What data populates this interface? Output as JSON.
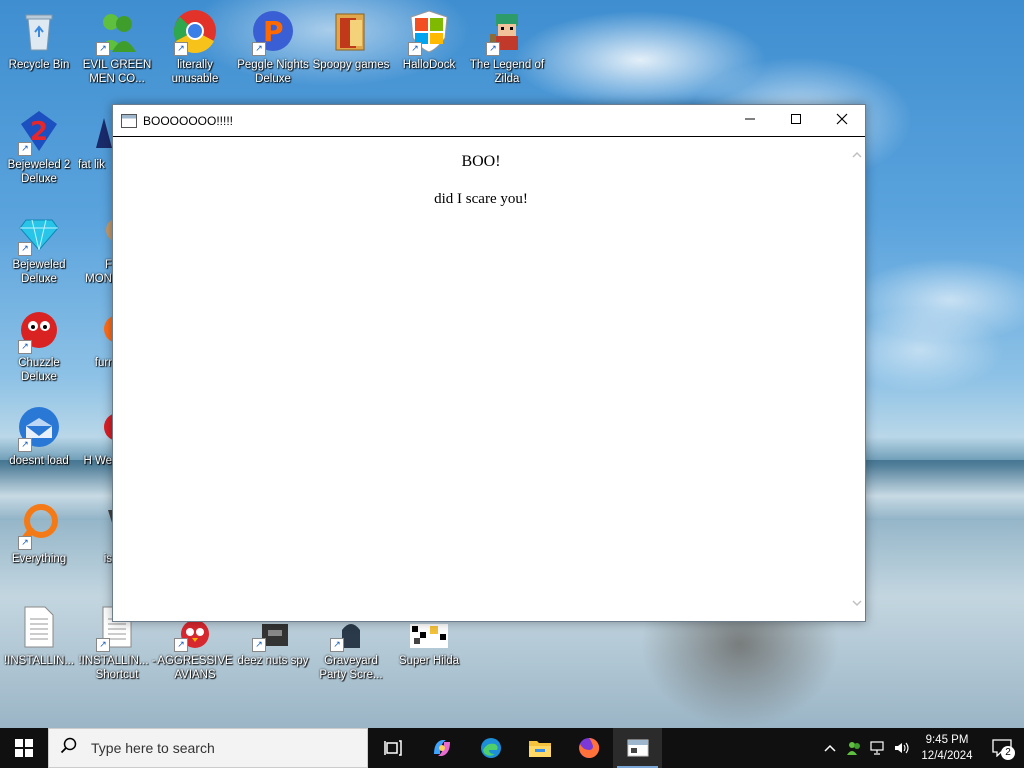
{
  "desktop": {
    "icons": [
      {
        "label": "Recycle Bin",
        "icon": "recycle-bin-icon"
      },
      {
        "label": "EVIL GREEN MEN CO...",
        "icon": "green-men-icon"
      },
      {
        "label": "literally unusable",
        "icon": "chrome-icon"
      },
      {
        "label": "Peggle Nights Deluxe",
        "icon": "peggle-icon"
      },
      {
        "label": "Spoopy games",
        "icon": "folder-icon"
      },
      {
        "label": "HalloDock",
        "icon": "shield-icon"
      },
      {
        "label": "The Legend of Zilda",
        "icon": "pixel-hero-icon"
      },
      {
        "label": "Bejeweled 2 Deluxe",
        "icon": "bejeweled2-icon"
      },
      {
        "label": "fat lik",
        "icon": "fat-icon"
      },
      {
        "label": "Bejeweled Deluxe",
        "icon": "diamond-icon"
      },
      {
        "label": "F MON",
        "icon": "monster-icon"
      },
      {
        "label": "Chuzzle Deluxe",
        "icon": "chuzzle-icon"
      },
      {
        "label": "furr",
        "icon": "firefox-icon"
      },
      {
        "label": "doesnt load",
        "icon": "thunderbird-icon"
      },
      {
        "label": "H We",
        "icon": "red-game-icon"
      },
      {
        "label": "Everything",
        "icon": "everything-search-icon"
      },
      {
        "label": "is",
        "icon": "dark-game-icon"
      },
      {
        "label": "!INSTALLIN...",
        "icon": "text-file-icon"
      },
      {
        "label": "!INSTALLIN... - Shortcut",
        "icon": "text-file-icon"
      },
      {
        "label": "AGGRESSIVE AVIANS",
        "icon": "angry-bird-icon"
      },
      {
        "label": "deez nuts spy",
        "icon": "spy-icon"
      },
      {
        "label": "Graveyard Party Scre...",
        "icon": "graveyard-icon"
      },
      {
        "label": "Super Hilda",
        "icon": "pixel-game-icon"
      }
    ]
  },
  "window": {
    "title": "BOOOOOOO!!!!!",
    "heading": "BOO!",
    "message": "did I scare you!"
  },
  "taskbar": {
    "search_placeholder": "Type here to search",
    "apps": [
      "task-view-icon",
      "copilot-icon",
      "edge-icon",
      "file-explorer-icon",
      "firefox-icon",
      "html-app-icon"
    ],
    "clock_time": "9:45 PM",
    "clock_date": "12/4/2024",
    "notification_count": "2"
  }
}
